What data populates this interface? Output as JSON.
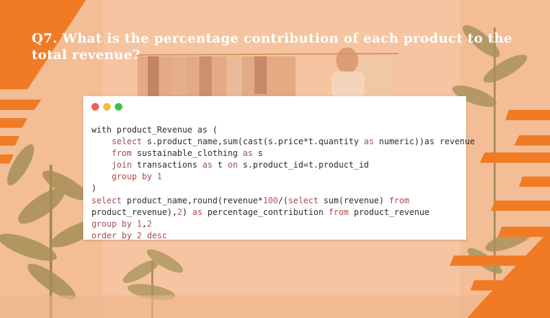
{
  "title": "Q7. What is the percentage contribution of each product to the total revenue?",
  "colors": {
    "accent_orange": "#f07b24",
    "overlay_peach": "#f2b98f",
    "title_text": "#ffffff",
    "code_keyword": "#a84a4a",
    "code_text": "#2b2b2b"
  },
  "window_controls": [
    "close-dot",
    "minimize-dot",
    "maximize-dot"
  ],
  "code_lines": [
    [
      {
        "t": "with product_Revenue as (",
        "c": "plain"
      }
    ],
    [
      {
        "t": "    ",
        "c": "plain"
      },
      {
        "t": "select",
        "c": "kw"
      },
      {
        "t": " s.product_name,sum(cast(s.price*t.quantity ",
        "c": "plain"
      },
      {
        "t": "as",
        "c": "kw"
      },
      {
        "t": " numeric))as revenue",
        "c": "plain"
      }
    ],
    [
      {
        "t": "    ",
        "c": "plain"
      },
      {
        "t": "from",
        "c": "kw"
      },
      {
        "t": " sustainable_clothing ",
        "c": "plain"
      },
      {
        "t": "as",
        "c": "kw"
      },
      {
        "t": " s",
        "c": "plain"
      }
    ],
    [
      {
        "t": "    ",
        "c": "plain"
      },
      {
        "t": "join",
        "c": "kw"
      },
      {
        "t": " transactions ",
        "c": "plain"
      },
      {
        "t": "as",
        "c": "kw"
      },
      {
        "t": " t ",
        "c": "plain"
      },
      {
        "t": "on",
        "c": "kw"
      },
      {
        "t": " s.product_id=t.product_id",
        "c": "plain"
      }
    ],
    [
      {
        "t": "    ",
        "c": "plain"
      },
      {
        "t": "group by",
        "c": "kw"
      },
      {
        "t": " ",
        "c": "plain"
      },
      {
        "t": "1",
        "c": "num"
      }
    ],
    [
      {
        "t": ")",
        "c": "plain"
      }
    ],
    [
      {
        "t": "select",
        "c": "kw"
      },
      {
        "t": " product_name,round(revenue*",
        "c": "plain"
      },
      {
        "t": "100",
        "c": "num"
      },
      {
        "t": "/(",
        "c": "plain"
      },
      {
        "t": "select",
        "c": "kw"
      },
      {
        "t": " sum(revenue) ",
        "c": "plain"
      },
      {
        "t": "from",
        "c": "kw"
      }
    ],
    [
      {
        "t": "product_revenue),",
        "c": "plain"
      },
      {
        "t": "2",
        "c": "num"
      },
      {
        "t": ") ",
        "c": "plain"
      },
      {
        "t": "as",
        "c": "kw"
      },
      {
        "t": " percentage_contribution ",
        "c": "plain"
      },
      {
        "t": "from",
        "c": "kw"
      },
      {
        "t": " product_revenue",
        "c": "plain"
      }
    ],
    [
      {
        "t": "group by",
        "c": "kw"
      },
      {
        "t": " ",
        "c": "plain"
      },
      {
        "t": "1",
        "c": "num"
      },
      {
        "t": ",",
        "c": "plain"
      },
      {
        "t": "2",
        "c": "num"
      }
    ],
    [
      {
        "t": "order by",
        "c": "kw"
      },
      {
        "t": " ",
        "c": "plain"
      },
      {
        "t": "2",
        "c": "num"
      },
      {
        "t": " ",
        "c": "plain"
      },
      {
        "t": "desc",
        "c": "kw"
      }
    ]
  ]
}
